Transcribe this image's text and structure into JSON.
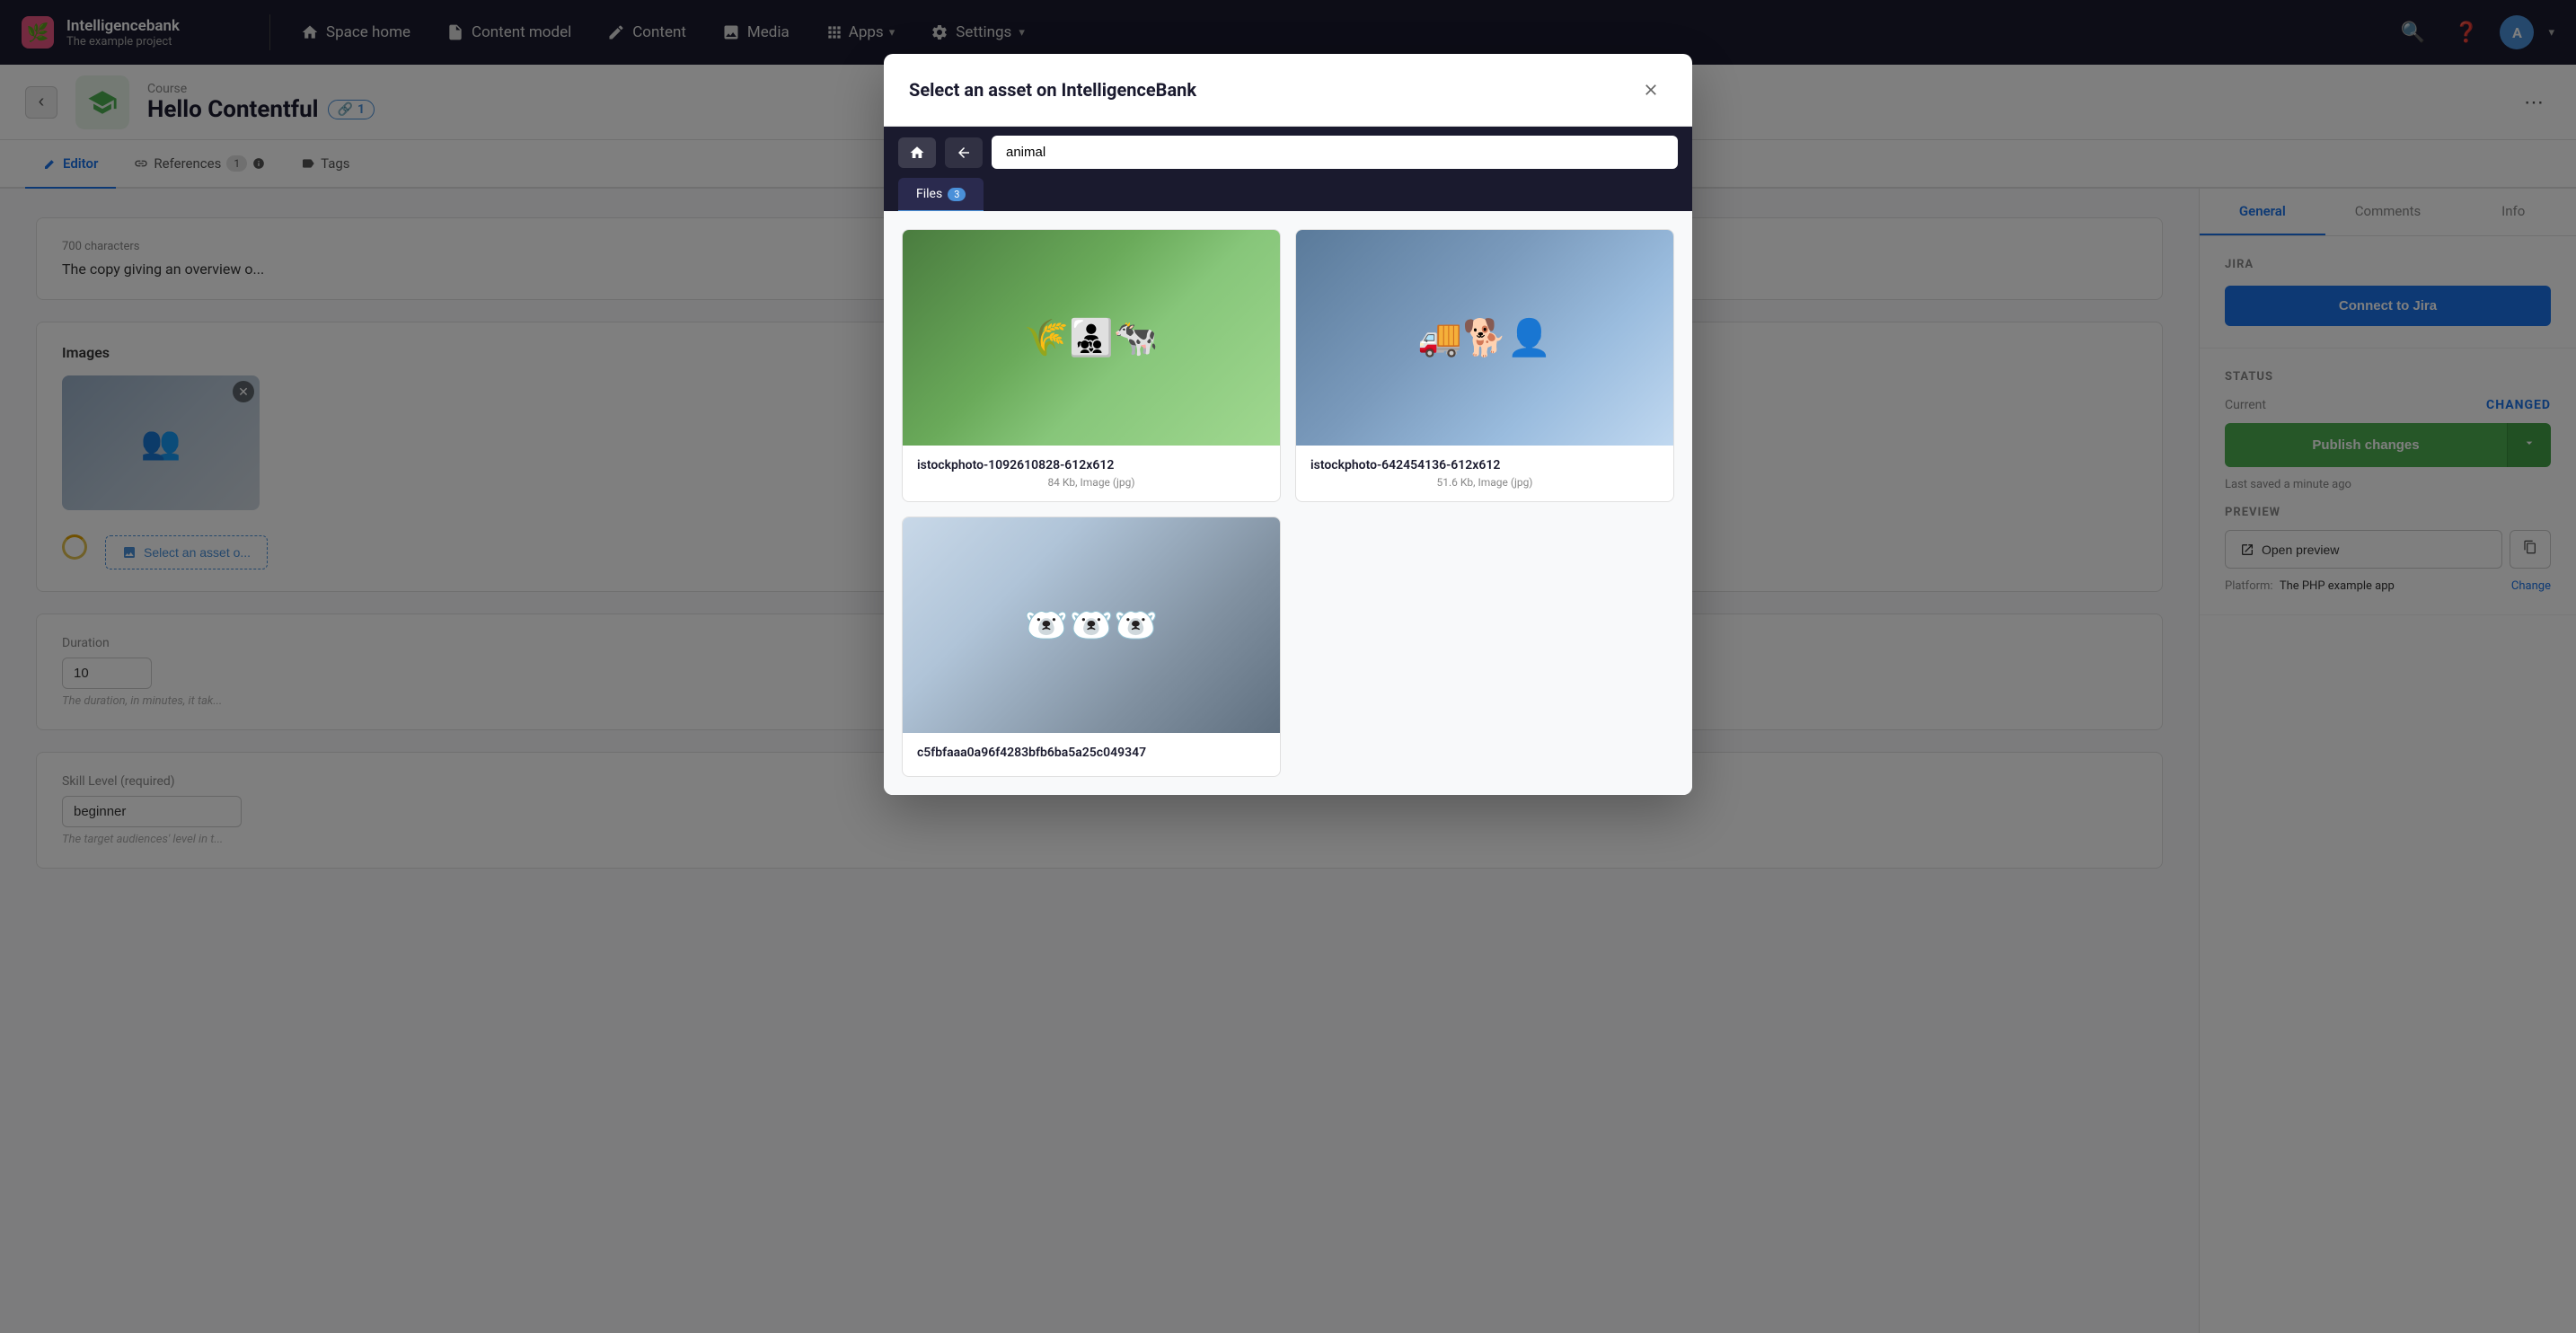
{
  "app": {
    "name": "Intelligencebank",
    "subtitle": "The example project",
    "logo_char": "🌿"
  },
  "nav": {
    "space_home": "Space home",
    "content_model": "Content model",
    "content": "Content",
    "media": "Media",
    "apps": "Apps",
    "settings": "Settings"
  },
  "entry": {
    "type": "Course",
    "title": "Hello Contentful",
    "link_count": "1"
  },
  "tabs": {
    "editor": "Editor",
    "references": "References",
    "references_count": "1",
    "tags": "Tags"
  },
  "fields": {
    "char_count": "700 characters",
    "copy_hint": "The copy giving an overview o...",
    "images_label": "Images",
    "select_asset_label": "Select an asset o...",
    "duration_label": "Duration",
    "duration_value": "10",
    "duration_hint": "The duration, in minutes, it tak...",
    "skill_label": "Skill Level (required)",
    "skill_value": "beginner",
    "skill_hint": "The target audiences' level in t..."
  },
  "sidebar": {
    "tabs": {
      "general": "General",
      "comments": "Comments",
      "info": "Info"
    },
    "jira_section": "JIRA",
    "connect_jira": "Connect to Jira",
    "status_section": "STATUS",
    "status_current": "Current",
    "status_changed": "CHANGED",
    "publish_btn": "Publish changes",
    "last_saved": "Last saved a minute ago",
    "preview_section": "PREVIEW",
    "open_preview": "Open preview",
    "platform_label": "Platform:",
    "platform_value": "The PHP example app",
    "change_link": "Change"
  },
  "modal": {
    "title": "Select an asset on IntelligenceBank",
    "search_value": "animal",
    "files_tab": "Files",
    "files_count": "3",
    "assets": [
      {
        "id": "asset-1",
        "name": "istockphoto-1092610828-612x612",
        "meta": "84 Kb, Image (jpg)",
        "img_class": "img-farm"
      },
      {
        "id": "asset-2",
        "name": "istockphoto-642454136-612x612",
        "meta": "51.6 Kb, Image (jpg)",
        "img_class": "img-man-dog"
      },
      {
        "id": "asset-3",
        "name": "c5fbfaaa0a96f4283bfb6ba5a25c049347",
        "meta": "",
        "img_class": "img-bears"
      }
    ]
  }
}
